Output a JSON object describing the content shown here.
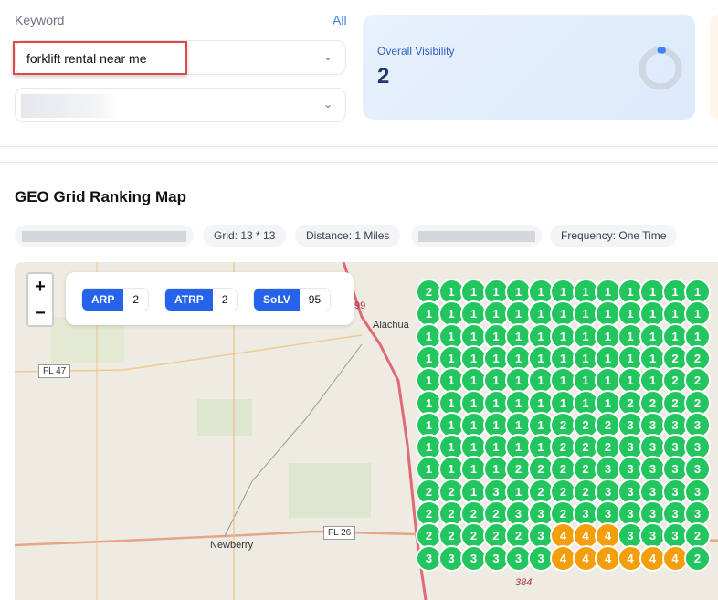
{
  "keyword": {
    "label": "Keyword",
    "all_link": "All",
    "selected": "forklift rental near me"
  },
  "visibility": {
    "title": "Overall Visibility",
    "value": "2",
    "donut_percent": 2,
    "accent": "#3b82f6"
  },
  "section": {
    "title": "GEO Grid Ranking Map"
  },
  "chips": [
    "Grid: 13 * 13",
    "Distance: 1 Miles",
    "Frequency: One Time"
  ],
  "map": {
    "zoom_in": "+",
    "zoom_out": "−",
    "metrics": [
      {
        "key": "ARP",
        "value": "2"
      },
      {
        "key": "ATRP",
        "value": "2"
      },
      {
        "key": "SoLV",
        "value": "95"
      }
    ],
    "labels": {
      "alachua": "Alachua",
      "newberry": "Newberry",
      "fl47": "FL 47",
      "fl26": "FL 26",
      "r384": "384",
      "r99": "99"
    },
    "colors": {
      "top3": "#22c55e",
      "mid": "#f59e0b"
    },
    "grid": [
      [
        2,
        1,
        1,
        1,
        1,
        1,
        1,
        1,
        1,
        1,
        1,
        1,
        1
      ],
      [
        1,
        1,
        1,
        1,
        1,
        1,
        1,
        1,
        1,
        1,
        1,
        1,
        1
      ],
      [
        1,
        1,
        1,
        1,
        1,
        1,
        1,
        1,
        1,
        1,
        1,
        1,
        1
      ],
      [
        1,
        1,
        1,
        1,
        1,
        1,
        1,
        1,
        1,
        1,
        1,
        2,
        2
      ],
      [
        1,
        1,
        1,
        1,
        1,
        1,
        1,
        1,
        1,
        1,
        1,
        2,
        2
      ],
      [
        1,
        1,
        1,
        1,
        1,
        1,
        1,
        1,
        1,
        2,
        2,
        2,
        2
      ],
      [
        1,
        1,
        1,
        1,
        1,
        1,
        2,
        2,
        2,
        3,
        3,
        3,
        3
      ],
      [
        1,
        1,
        1,
        1,
        1,
        1,
        2,
        2,
        2,
        3,
        3,
        3,
        3
      ],
      [
        1,
        1,
        1,
        1,
        2,
        2,
        2,
        2,
        3,
        3,
        3,
        3,
        3
      ],
      [
        2,
        2,
        1,
        3,
        1,
        2,
        2,
        2,
        3,
        3,
        3,
        3,
        3
      ],
      [
        2,
        2,
        2,
        2,
        3,
        3,
        2,
        3,
        3,
        3,
        3,
        3,
        3
      ],
      [
        2,
        2,
        2,
        2,
        2,
        3,
        4,
        4,
        4,
        3,
        3,
        3,
        2
      ],
      [
        3,
        3,
        3,
        3,
        3,
        3,
        4,
        4,
        4,
        4,
        4,
        4,
        2
      ]
    ]
  }
}
